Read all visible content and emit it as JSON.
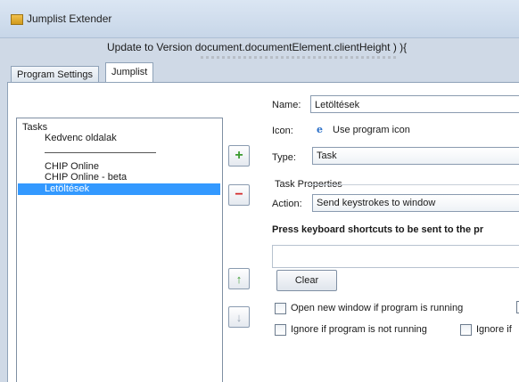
{
  "window": {
    "title": "Jumplist Extender"
  },
  "banner": {
    "text": "Update to Version  document.documentElement.clientHeight ) ){"
  },
  "tabs": [
    {
      "label": "Program Settings"
    },
    {
      "label": "Jumplist"
    }
  ],
  "tasks_list": {
    "items": [
      {
        "label": "Tasks",
        "indent": 0
      },
      {
        "label": "Kedvenc oldalak",
        "indent": 1
      },
      {
        "label": "CHIP Online",
        "indent": 1
      },
      {
        "label": "CHIP Online - beta",
        "indent": 1
      },
      {
        "label": "Letöltések",
        "indent": 1,
        "selected": true
      }
    ]
  },
  "side_buttons": {
    "add": "+",
    "remove": "−",
    "move_up": "↑",
    "move_down": "↓"
  },
  "form": {
    "name_label": "Name:",
    "name_value": "Letöltések",
    "icon_label": "Icon:",
    "icon_value": "Use program icon",
    "type_label": "Type:",
    "type_value": "Task",
    "task_properties_label": "Task Properties",
    "action_label": "Action:",
    "action_value": "Send keystrokes to window",
    "press_label": "Press keyboard shortcuts to be sent to the pr",
    "keys_value": "",
    "clear_label": "Clear",
    "opt_open_new": "Open new window if program is running",
    "opt_ignore_not_running": "Ignore if program is not running",
    "opt_ignore_if": "Ignore if"
  },
  "colors": {
    "selection": "#3399ff",
    "add_green": "#3a9a2e",
    "remove_red": "#d42a2a"
  }
}
